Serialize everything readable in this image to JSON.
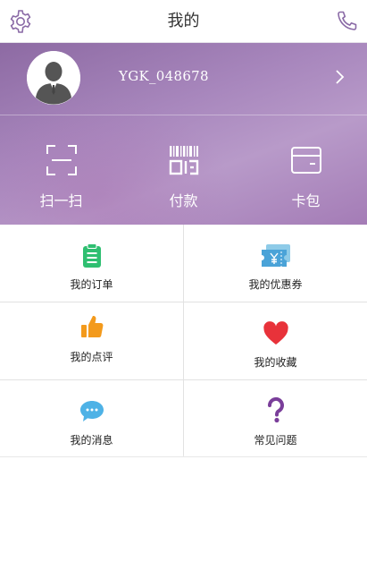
{
  "header": {
    "title": "我的",
    "settings_icon": "gear-icon",
    "phone_icon": "phone-icon"
  },
  "profile": {
    "username": "YGK_048678",
    "avatar_icon": "user-avatar-icon",
    "chevron_icon": "chevron-right-icon"
  },
  "quick_actions": [
    {
      "label": "扫一扫",
      "icon": "scan-icon"
    },
    {
      "label": "付款",
      "icon": "barcode-icon"
    },
    {
      "label": "卡包",
      "icon": "card-icon"
    }
  ],
  "menu": [
    {
      "label": "我的订单",
      "icon": "clipboard-icon",
      "color": "#2fbf71"
    },
    {
      "label": "我的优惠券",
      "icon": "coupon-icon",
      "color": "#4aa3d8"
    },
    {
      "label": "我的点评",
      "icon": "thumbs-up-icon",
      "color": "#f39a1c"
    },
    {
      "label": "我的收藏",
      "icon": "heart-icon",
      "color": "#e8323a"
    },
    {
      "label": "我的消息",
      "icon": "chat-bubble-icon",
      "color": "#4eb2e6"
    },
    {
      "label": "常见问题",
      "icon": "question-icon",
      "color": "#7a3e9a"
    }
  ],
  "colors": {
    "accent": "#a47cb6",
    "header_icon": "#8a6aa6"
  }
}
